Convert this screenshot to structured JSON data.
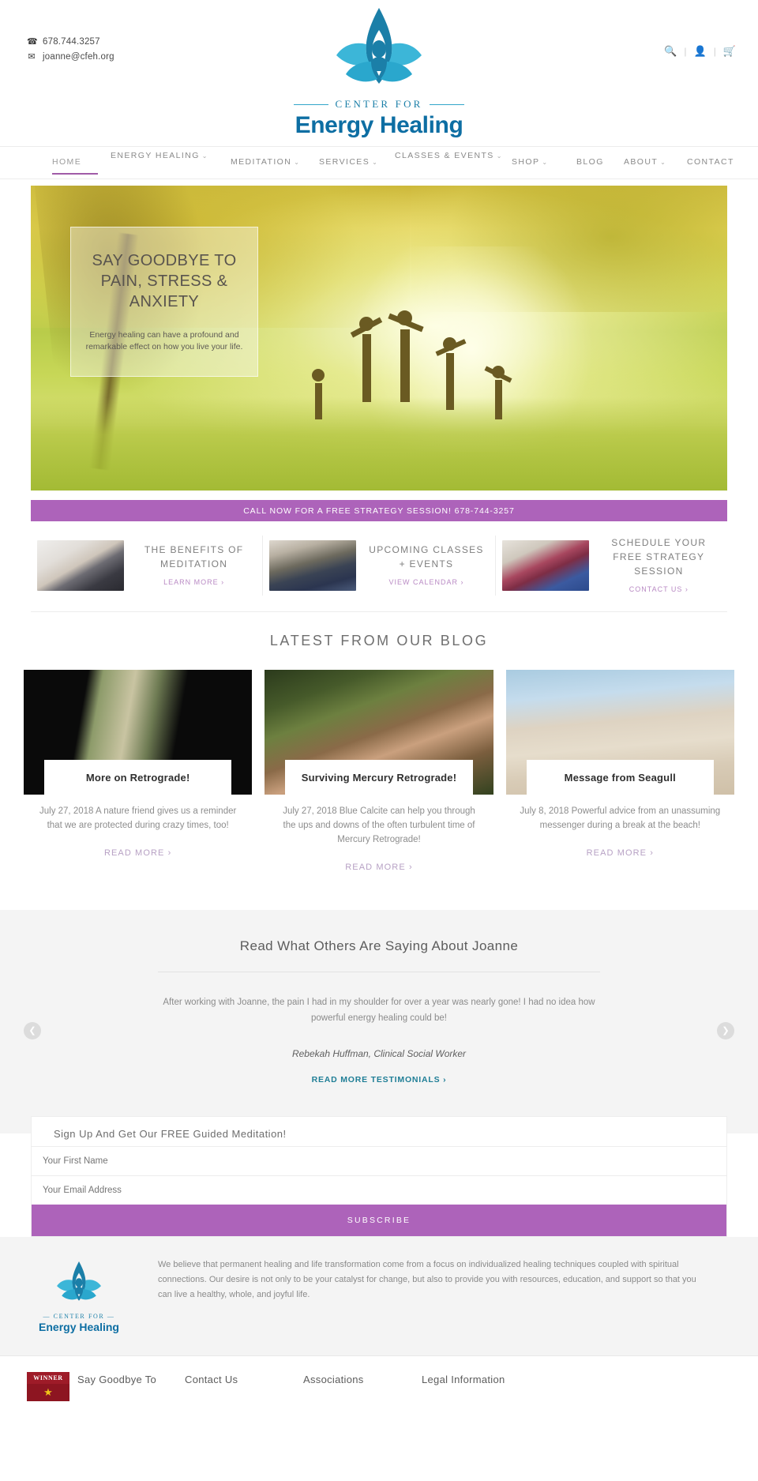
{
  "topbar": {
    "phone": "678.744.3257",
    "email": "joanne@cfeh.org",
    "phone_icon": "phone-icon",
    "email_icon": "envelope-icon"
  },
  "logo": {
    "center_for": "CENTER FOR",
    "name": "Energy Healing",
    "mark": "lotus-meditation-icon"
  },
  "utility": {
    "search_icon": "search-icon",
    "account_icon": "user-icon",
    "cart_icon": "shopping-cart-icon",
    "divider": "|"
  },
  "nav": {
    "items": [
      {
        "label": "HOME",
        "caret": false,
        "active": true
      },
      {
        "label": "ENERGY HEALING",
        "caret": true,
        "active": false
      },
      {
        "label": "MEDITATION",
        "caret": true,
        "active": false
      },
      {
        "label": "SERVICES",
        "caret": true,
        "active": false
      },
      {
        "label": "CLASSES & EVENTS",
        "caret": true,
        "active": false
      },
      {
        "label": "SHOP",
        "caret": true,
        "active": false
      },
      {
        "label": "BLOG",
        "caret": false,
        "active": false
      },
      {
        "label": "ABOUT",
        "caret": true,
        "active": false
      },
      {
        "label": "CONTACT",
        "caret": false,
        "active": false
      }
    ]
  },
  "hero": {
    "title": "SAY GOODBYE TO PAIN, STRESS & ANXIETY",
    "subtitle": "Energy healing can have a profound and remarkable effect on how you live your life."
  },
  "cta_band": {
    "text": "CALL NOW FOR A FREE STRATEGY SESSION! 678-744-3257",
    "color": "#ad63ba"
  },
  "features": [
    {
      "title": "THE BENEFITS OF MEDITATION",
      "link": "LEARN MORE ›",
      "image": "meditation-photo"
    },
    {
      "title": "UPCOMING CLASSES + EVENTS",
      "link": "VIEW CALENDAR ›",
      "image": "classes-photo"
    },
    {
      "title": "SCHEDULE YOUR FREE STRATEGY SESSION",
      "link": "CONTACT US ›",
      "image": "handshake-photo"
    }
  ],
  "blog": {
    "heading": "LATEST FROM OUR BLOG",
    "posts": [
      {
        "title": "More on Retrograde!",
        "excerpt": "July 27, 2018  A nature friend gives us a reminder that we are protected during crazy times, too!",
        "link": "READ MORE ›",
        "image": "retrograde-video-thumb"
      },
      {
        "title": "Surviving Mercury Retrograde!",
        "excerpt": "July 27, 2018 Blue Calcite can help you through the ups and downs of the often turbulent time of Mercury Retrograde!",
        "link": "READ MORE ›",
        "image": "mercury-retrograde-photo"
      },
      {
        "title": "Message from Seagull",
        "excerpt": "July 8, 2018 Powerful advice from an unassuming messenger during a break at the beach!",
        "link": "READ MORE ›",
        "image": "seagull-beach-photo"
      }
    ]
  },
  "testimonials": {
    "heading": "Read What Others Are Saying About Joanne",
    "quote": "After working with Joanne, the pain I had in my shoulder for over a year was nearly gone! I had no idea how powerful energy healing could be!",
    "author": "Rebekah Huffman, Clinical Social Worker",
    "link": "READ MORE TESTIMONIALS ›",
    "prev_icon": "chevron-left-icon",
    "next_icon": "chevron-right-icon"
  },
  "signup": {
    "heading": "Sign Up And Get Our FREE Guided Meditation!",
    "first_name_placeholder": "Your First Name",
    "first_name_value": "",
    "email_placeholder": "Your Email Address",
    "email_value": "",
    "button": "SUBSCRIBE"
  },
  "footer": {
    "logo_center_for": "— CENTER FOR —",
    "logo_name": "Energy Healing",
    "blurb": "We believe that permanent healing and life transformation come from a focus on individualized healing techniques coupled with spiritual connections. Our desire is not only to be your catalyst for change, but also to provide you with resources, education, and support so that you can live a healthy, whole, and joyful life.",
    "badge_top": "WINNER",
    "badge_star": "★",
    "columns": [
      {
        "title": "Say Goodbye To"
      },
      {
        "title": "Contact Us"
      },
      {
        "title": "Associations"
      },
      {
        "title": "Legal Information"
      }
    ]
  }
}
